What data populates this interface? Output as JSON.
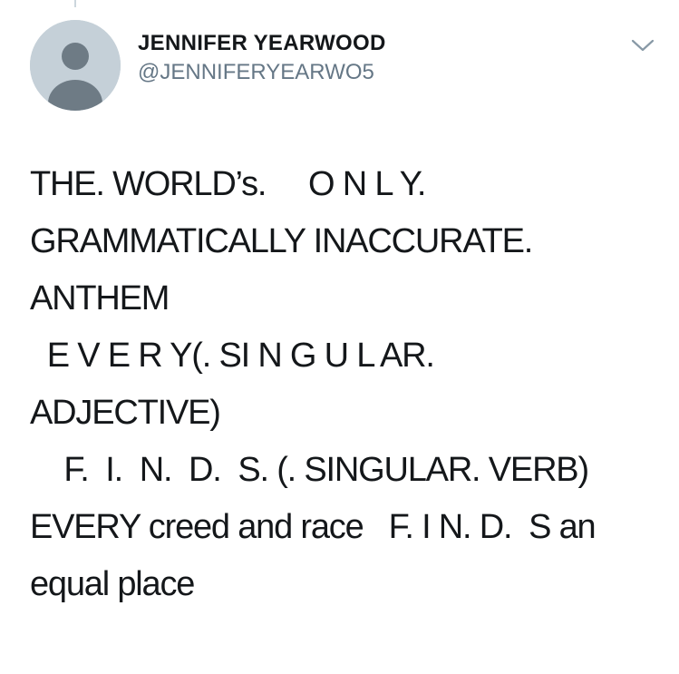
{
  "tweet": {
    "author": {
      "display_name": "JENNIFER YEARWOOD",
      "handle": "@JENNIFERYEARWO5",
      "avatar_icon": "default-profile-avatar-icon"
    },
    "menu_icon": "chevron-down-icon",
    "text_lines": [
      "THE. WORLD’s.     O N L Y.",
      "GRAMMATICALLY INACCURATE.",
      "ANTHEM",
      "  E V E R Y(. SI N G U L AR.",
      "ADJECTIVE)",
      "    F.  I.  N.  D.  S. (. SINGULAR. VERB)",
      "EVERY creed and race   F. I N. D.  S an",
      "equal place"
    ]
  },
  "colors": {
    "text_primary": "#14171a",
    "text_secondary": "#657786",
    "avatar_bg": "#c5d0d8",
    "avatar_fg": "#6e7b85"
  }
}
